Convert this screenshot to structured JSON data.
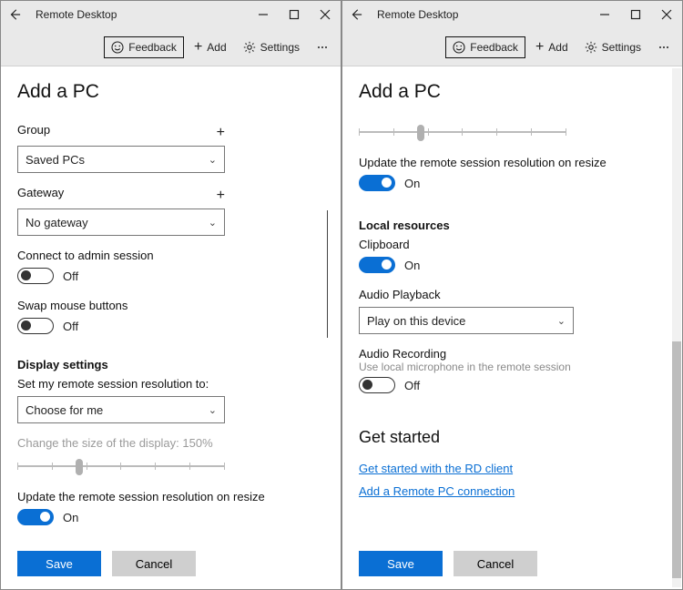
{
  "app_title": "Remote Desktop",
  "toolbar": {
    "feedback": "Feedback",
    "add": "Add",
    "settings": "Settings"
  },
  "page_title": "Add a PC",
  "left": {
    "group_label": "Group",
    "group_value": "Saved PCs",
    "gateway_label": "Gateway",
    "gateway_value": "No gateway",
    "admin_label": "Connect to admin session",
    "admin_value": "Off",
    "swap_label": "Swap mouse buttons",
    "swap_value": "Off",
    "display_heading": "Display settings",
    "resolution_label": "Set my remote session resolution to:",
    "resolution_value": "Choose for me",
    "scale_label": "Change the size of the display: 150%",
    "resize_label": "Update the remote session resolution on resize",
    "resize_value": "On"
  },
  "right": {
    "resize_label": "Update the remote session resolution on resize",
    "resize_value": "On",
    "local_heading": "Local resources",
    "clipboard_label": "Clipboard",
    "clipboard_value": "On",
    "audio_play_label": "Audio Playback",
    "audio_play_value": "Play on this device",
    "audio_rec_label": "Audio Recording",
    "audio_rec_sub": "Use local microphone in the remote session",
    "audio_rec_value": "Off",
    "get_started_heading": "Get started",
    "link1": "Get started with the RD client",
    "link2": "Add a Remote PC connection"
  },
  "buttons": {
    "save": "Save",
    "cancel": "Cancel"
  }
}
